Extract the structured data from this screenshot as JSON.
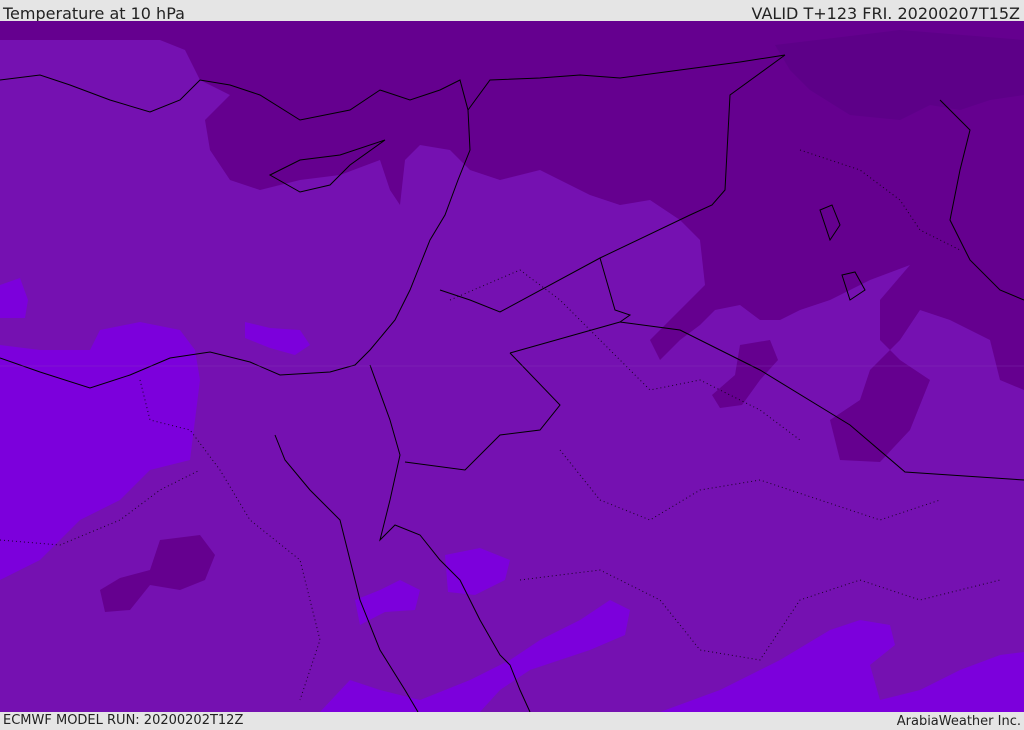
{
  "header": {
    "title": "Temperature at 10 hPa",
    "valid": "VALID T+123 FRI. 20200207T15Z"
  },
  "footer": {
    "model_run": "ECMWF MODEL RUN: 20200202T12Z",
    "brand": "ArabiaWeather Inc."
  },
  "map": {
    "colors": {
      "dark": "#65008f",
      "mid": "#7511b1",
      "light": "#7c00dc",
      "border": "#000000"
    }
  }
}
